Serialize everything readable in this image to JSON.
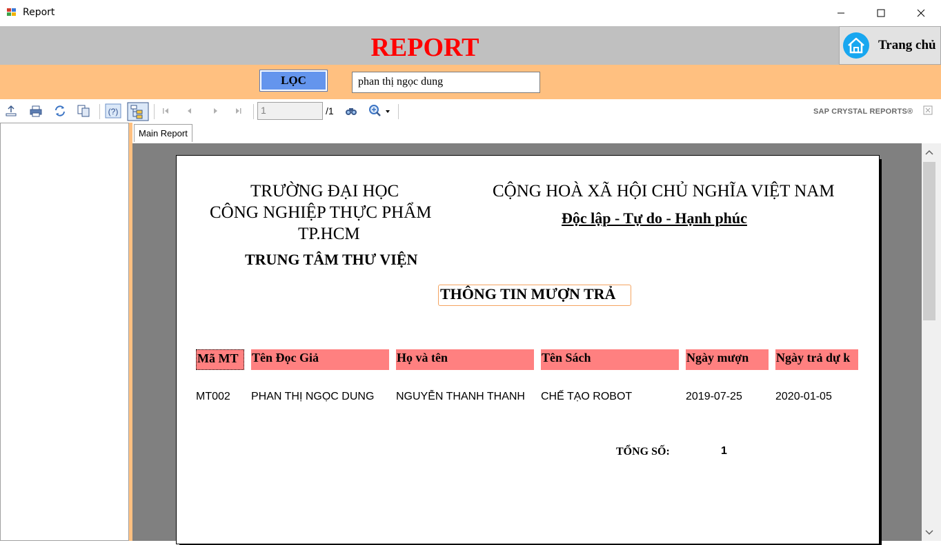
{
  "window": {
    "title": "Report",
    "icons": [
      "app-icon",
      "minimize-icon",
      "maximize-icon",
      "close-icon"
    ]
  },
  "header": {
    "title": "REPORT",
    "home_button": {
      "label": "Trang chủ",
      "icon": "home-icon"
    }
  },
  "filter": {
    "button_label": "LỌC",
    "input_value": "phan thị ngọc dung"
  },
  "toolbar": {
    "icons": [
      "export-icon",
      "print-icon",
      "refresh-icon",
      "copy-icon",
      "help-icon",
      "group-tree-icon",
      "first-page-icon",
      "prev-page-icon",
      "next-page-icon",
      "last-page-icon",
      "find-icon",
      "zoom-icon"
    ],
    "page_number": "1",
    "page_total": "/1",
    "brand": "SAP CRYSTAL REPORTS®"
  },
  "tabs": {
    "main": "Main Report"
  },
  "report": {
    "school_line1": "TRƯỜNG ĐẠI HỌC",
    "school_line2": "CÔNG NGHIỆP THỰC PHẨM",
    "school_line3": "TP.HCM",
    "library": "TRUNG TÂM THƯ VIỆN",
    "nation": "CỘNG HOÀ XÃ HỘI CHỦ NGHĨA VIỆT NAM",
    "motto": "Độc lập - Tự do - Hạnh phúc",
    "title": "THÔNG TIN MƯỢN TRẢ",
    "columns": [
      "Mã MT",
      "Tên Đọc Giả",
      "Họ và tên",
      "Tên Sách",
      "Ngày mượn",
      "Ngày trả dự k"
    ],
    "rows": [
      [
        "MT002",
        "PHAN THỊ NGỌC DUNG",
        "NGUYỄN THANH THANH",
        "CHẾ TẠO ROBOT",
        "2019-07-25",
        "2020-01-05"
      ]
    ],
    "total_label": "TỔNG SỐ:",
    "total_value": "1"
  },
  "colors": {
    "header_bg": "#c0c0c0",
    "title_red": "#ff0000",
    "filter_bg": "#ffc080",
    "filter_button": "#6495ed",
    "column_header_bg": "#ff8080",
    "viewport_bg": "#808080"
  }
}
